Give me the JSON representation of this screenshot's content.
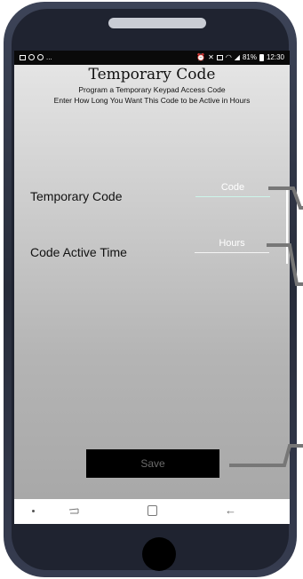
{
  "status_bar": {
    "left_icons": [
      "image-icon",
      "sync-icon",
      "whatsapp-icon"
    ],
    "left_overflow": "...",
    "right_icons": [
      "alarm-icon",
      "mute-icon",
      "nfc-icon",
      "wifi-icon",
      "signal-icon"
    ],
    "battery_percent": "81%",
    "time": "12:30"
  },
  "header": {
    "title": "Temporary Code",
    "subtitle_line1": "Program a Temporary Keypad Access Code",
    "subtitle_line2": "Enter How Long You Want This Code to be Active in Hours"
  },
  "form": {
    "code_label": "Temporary Code",
    "code_placeholder": "Code",
    "hours_label": "Code Active Time",
    "hours_placeholder": "Hours"
  },
  "actions": {
    "save_label": "Save"
  },
  "navigation_bar": {
    "icons": [
      "dot-icon",
      "recent-apps-icon",
      "home-icon",
      "back-icon"
    ],
    "back_glyph": "←"
  },
  "colors": {
    "phone_frame": "#2b3040",
    "save_button_bg": "#000000",
    "save_button_text": "#6a6a6a",
    "status_bar_bg": "#0a0a0a",
    "nav_bar_bg": "#ffffff"
  }
}
